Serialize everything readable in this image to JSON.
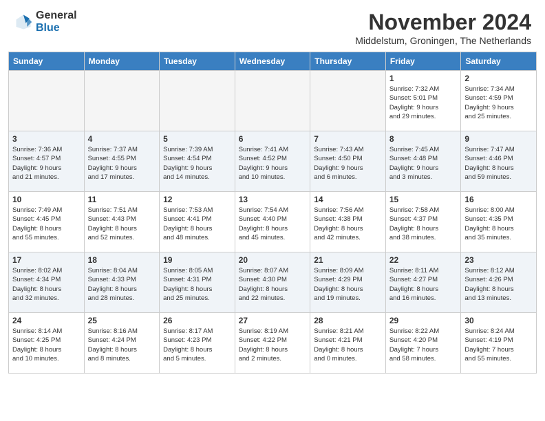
{
  "header": {
    "logo_general": "General",
    "logo_blue": "Blue",
    "month_title": "November 2024",
    "subtitle": "Middelstum, Groningen, The Netherlands"
  },
  "days_of_week": [
    "Sunday",
    "Monday",
    "Tuesday",
    "Wednesday",
    "Thursday",
    "Friday",
    "Saturday"
  ],
  "weeks": [
    [
      {
        "day": "",
        "info": "",
        "empty": true
      },
      {
        "day": "",
        "info": "",
        "empty": true
      },
      {
        "day": "",
        "info": "",
        "empty": true
      },
      {
        "day": "",
        "info": "",
        "empty": true
      },
      {
        "day": "",
        "info": "",
        "empty": true
      },
      {
        "day": "1",
        "info": "Sunrise: 7:32 AM\nSunset: 5:01 PM\nDaylight: 9 hours\nand 29 minutes."
      },
      {
        "day": "2",
        "info": "Sunrise: 7:34 AM\nSunset: 4:59 PM\nDaylight: 9 hours\nand 25 minutes."
      }
    ],
    [
      {
        "day": "3",
        "info": "Sunrise: 7:36 AM\nSunset: 4:57 PM\nDaylight: 9 hours\nand 21 minutes."
      },
      {
        "day": "4",
        "info": "Sunrise: 7:37 AM\nSunset: 4:55 PM\nDaylight: 9 hours\nand 17 minutes."
      },
      {
        "day": "5",
        "info": "Sunrise: 7:39 AM\nSunset: 4:54 PM\nDaylight: 9 hours\nand 14 minutes."
      },
      {
        "day": "6",
        "info": "Sunrise: 7:41 AM\nSunset: 4:52 PM\nDaylight: 9 hours\nand 10 minutes."
      },
      {
        "day": "7",
        "info": "Sunrise: 7:43 AM\nSunset: 4:50 PM\nDaylight: 9 hours\nand 6 minutes."
      },
      {
        "day": "8",
        "info": "Sunrise: 7:45 AM\nSunset: 4:48 PM\nDaylight: 9 hours\nand 3 minutes."
      },
      {
        "day": "9",
        "info": "Sunrise: 7:47 AM\nSunset: 4:46 PM\nDaylight: 8 hours\nand 59 minutes."
      }
    ],
    [
      {
        "day": "10",
        "info": "Sunrise: 7:49 AM\nSunset: 4:45 PM\nDaylight: 8 hours\nand 55 minutes."
      },
      {
        "day": "11",
        "info": "Sunrise: 7:51 AM\nSunset: 4:43 PM\nDaylight: 8 hours\nand 52 minutes."
      },
      {
        "day": "12",
        "info": "Sunrise: 7:53 AM\nSunset: 4:41 PM\nDaylight: 8 hours\nand 48 minutes."
      },
      {
        "day": "13",
        "info": "Sunrise: 7:54 AM\nSunset: 4:40 PM\nDaylight: 8 hours\nand 45 minutes."
      },
      {
        "day": "14",
        "info": "Sunrise: 7:56 AM\nSunset: 4:38 PM\nDaylight: 8 hours\nand 42 minutes."
      },
      {
        "day": "15",
        "info": "Sunrise: 7:58 AM\nSunset: 4:37 PM\nDaylight: 8 hours\nand 38 minutes."
      },
      {
        "day": "16",
        "info": "Sunrise: 8:00 AM\nSunset: 4:35 PM\nDaylight: 8 hours\nand 35 minutes."
      }
    ],
    [
      {
        "day": "17",
        "info": "Sunrise: 8:02 AM\nSunset: 4:34 PM\nDaylight: 8 hours\nand 32 minutes."
      },
      {
        "day": "18",
        "info": "Sunrise: 8:04 AM\nSunset: 4:33 PM\nDaylight: 8 hours\nand 28 minutes."
      },
      {
        "day": "19",
        "info": "Sunrise: 8:05 AM\nSunset: 4:31 PM\nDaylight: 8 hours\nand 25 minutes."
      },
      {
        "day": "20",
        "info": "Sunrise: 8:07 AM\nSunset: 4:30 PM\nDaylight: 8 hours\nand 22 minutes."
      },
      {
        "day": "21",
        "info": "Sunrise: 8:09 AM\nSunset: 4:29 PM\nDaylight: 8 hours\nand 19 minutes."
      },
      {
        "day": "22",
        "info": "Sunrise: 8:11 AM\nSunset: 4:27 PM\nDaylight: 8 hours\nand 16 minutes."
      },
      {
        "day": "23",
        "info": "Sunrise: 8:12 AM\nSunset: 4:26 PM\nDaylight: 8 hours\nand 13 minutes."
      }
    ],
    [
      {
        "day": "24",
        "info": "Sunrise: 8:14 AM\nSunset: 4:25 PM\nDaylight: 8 hours\nand 10 minutes."
      },
      {
        "day": "25",
        "info": "Sunrise: 8:16 AM\nSunset: 4:24 PM\nDaylight: 8 hours\nand 8 minutes."
      },
      {
        "day": "26",
        "info": "Sunrise: 8:17 AM\nSunset: 4:23 PM\nDaylight: 8 hours\nand 5 minutes."
      },
      {
        "day": "27",
        "info": "Sunrise: 8:19 AM\nSunset: 4:22 PM\nDaylight: 8 hours\nand 2 minutes."
      },
      {
        "day": "28",
        "info": "Sunrise: 8:21 AM\nSunset: 4:21 PM\nDaylight: 8 hours\nand 0 minutes."
      },
      {
        "day": "29",
        "info": "Sunrise: 8:22 AM\nSunset: 4:20 PM\nDaylight: 7 hours\nand 58 minutes."
      },
      {
        "day": "30",
        "info": "Sunrise: 8:24 AM\nSunset: 4:19 PM\nDaylight: 7 hours\nand 55 minutes."
      }
    ]
  ]
}
